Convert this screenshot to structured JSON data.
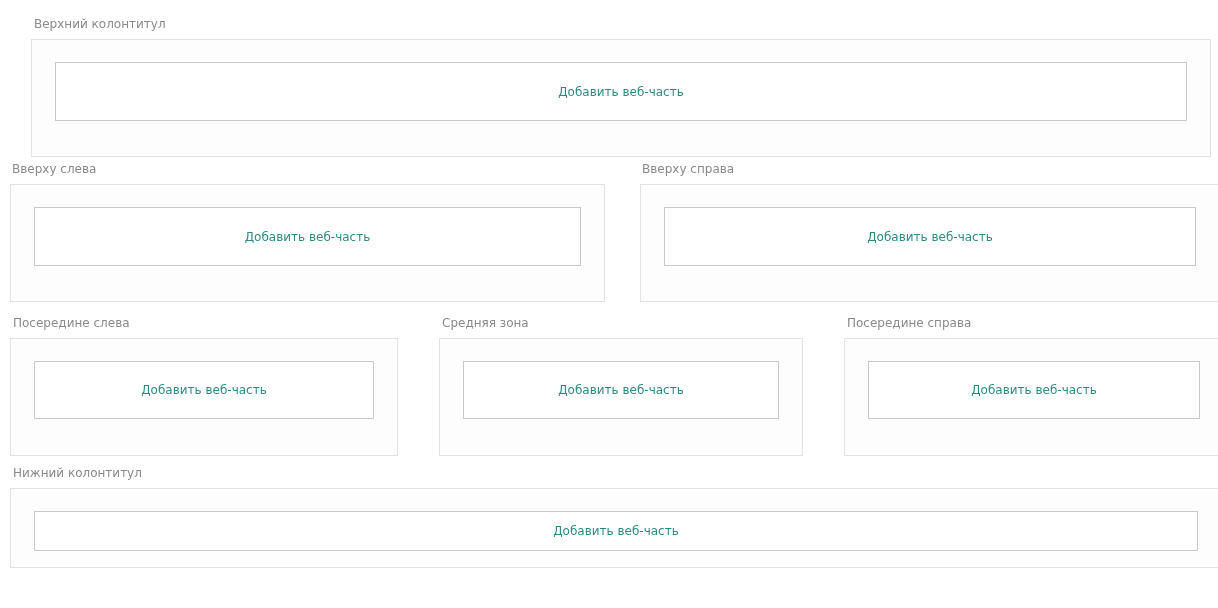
{
  "rows": [
    {
      "zones": [
        {
          "label": "Верхний колонтитул",
          "button": "Добавить веб-часть"
        }
      ]
    },
    {
      "zones": [
        {
          "label": "Вверху слева",
          "button": "Добавить веб-часть"
        },
        {
          "label": "Вверху справа",
          "button": "Добавить веб-часть"
        }
      ]
    },
    {
      "zones": [
        {
          "label": "Посередине слева",
          "button": "Добавить веб-часть"
        },
        {
          "label": "Средняя зона",
          "button": "Добавить веб-часть"
        },
        {
          "label": "Посередине справа",
          "button": "Добавить веб-часть"
        }
      ]
    },
    {
      "zones": [
        {
          "label": "Нижний колонтитул",
          "button": "Добавить веб-часть"
        }
      ]
    }
  ]
}
